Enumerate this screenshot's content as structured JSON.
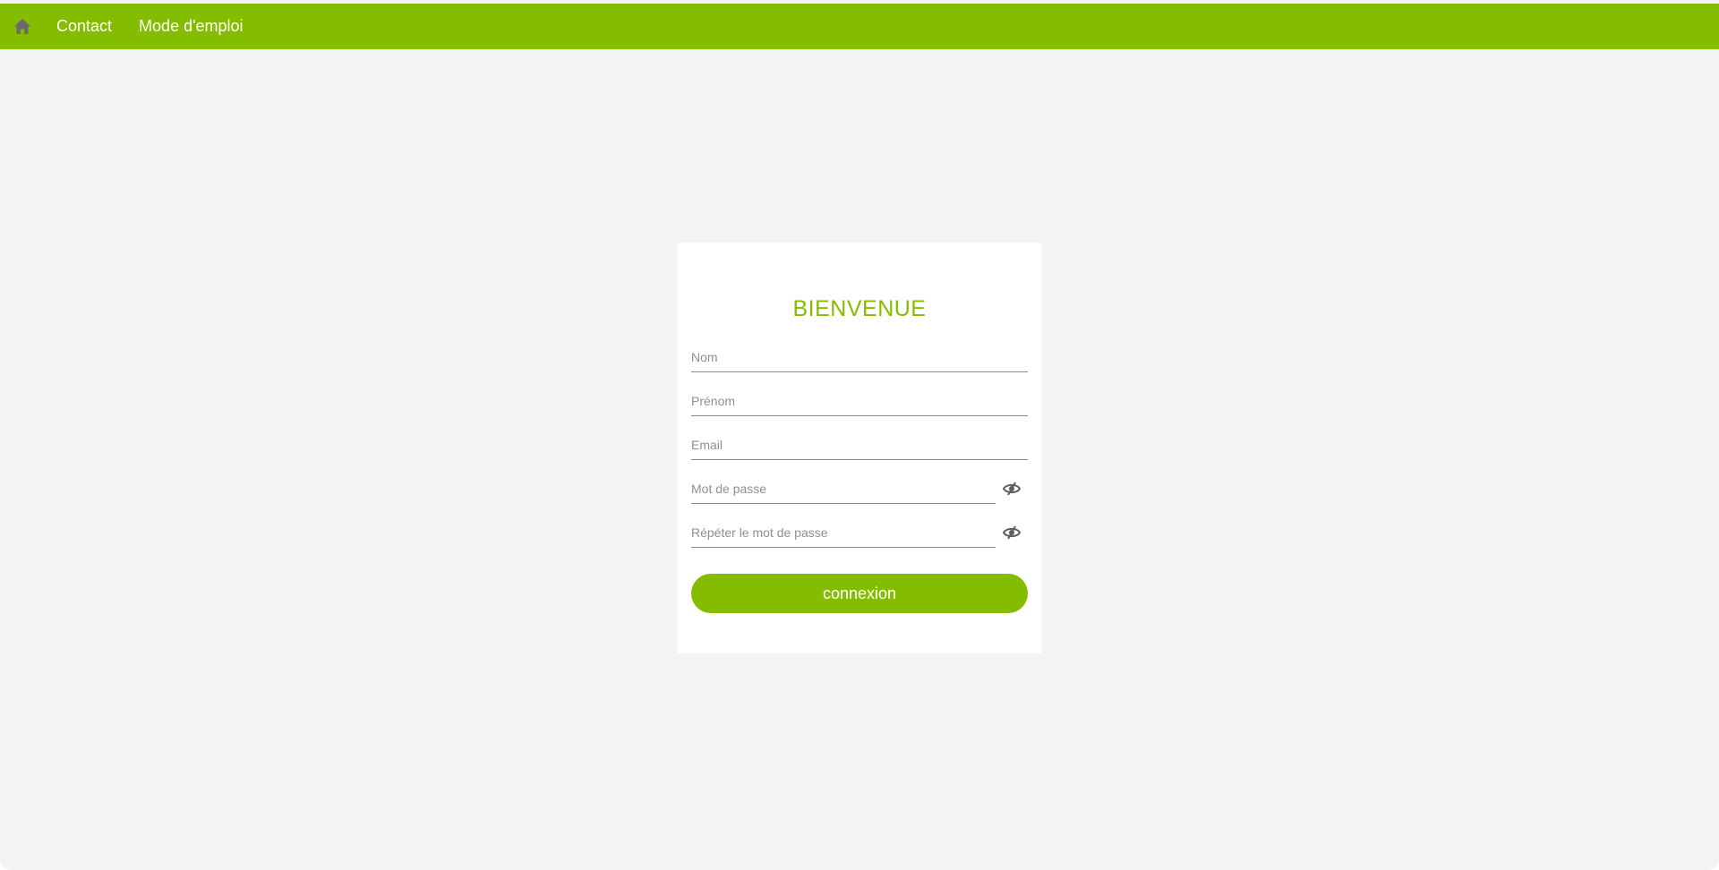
{
  "colors": {
    "accent": "#84bd00",
    "background": "#f4f4f4",
    "card": "#ffffff"
  },
  "navbar": {
    "home_icon": "home-icon",
    "links": [
      {
        "label": "Contact"
      },
      {
        "label": "Mode d'emploi"
      }
    ]
  },
  "form": {
    "title": "BIENVENUE",
    "fields": {
      "nom": {
        "placeholder": "Nom",
        "value": ""
      },
      "prenom": {
        "placeholder": "Prénom",
        "value": ""
      },
      "email": {
        "placeholder": "Email",
        "value": ""
      },
      "password": {
        "placeholder": "Mot de passe",
        "value": "",
        "toggle_icon": "eye-slash-icon"
      },
      "password_repeat": {
        "placeholder": "Répéter le mot de passe",
        "value": "",
        "toggle_icon": "eye-slash-icon"
      }
    },
    "submit_label": "connexion"
  }
}
